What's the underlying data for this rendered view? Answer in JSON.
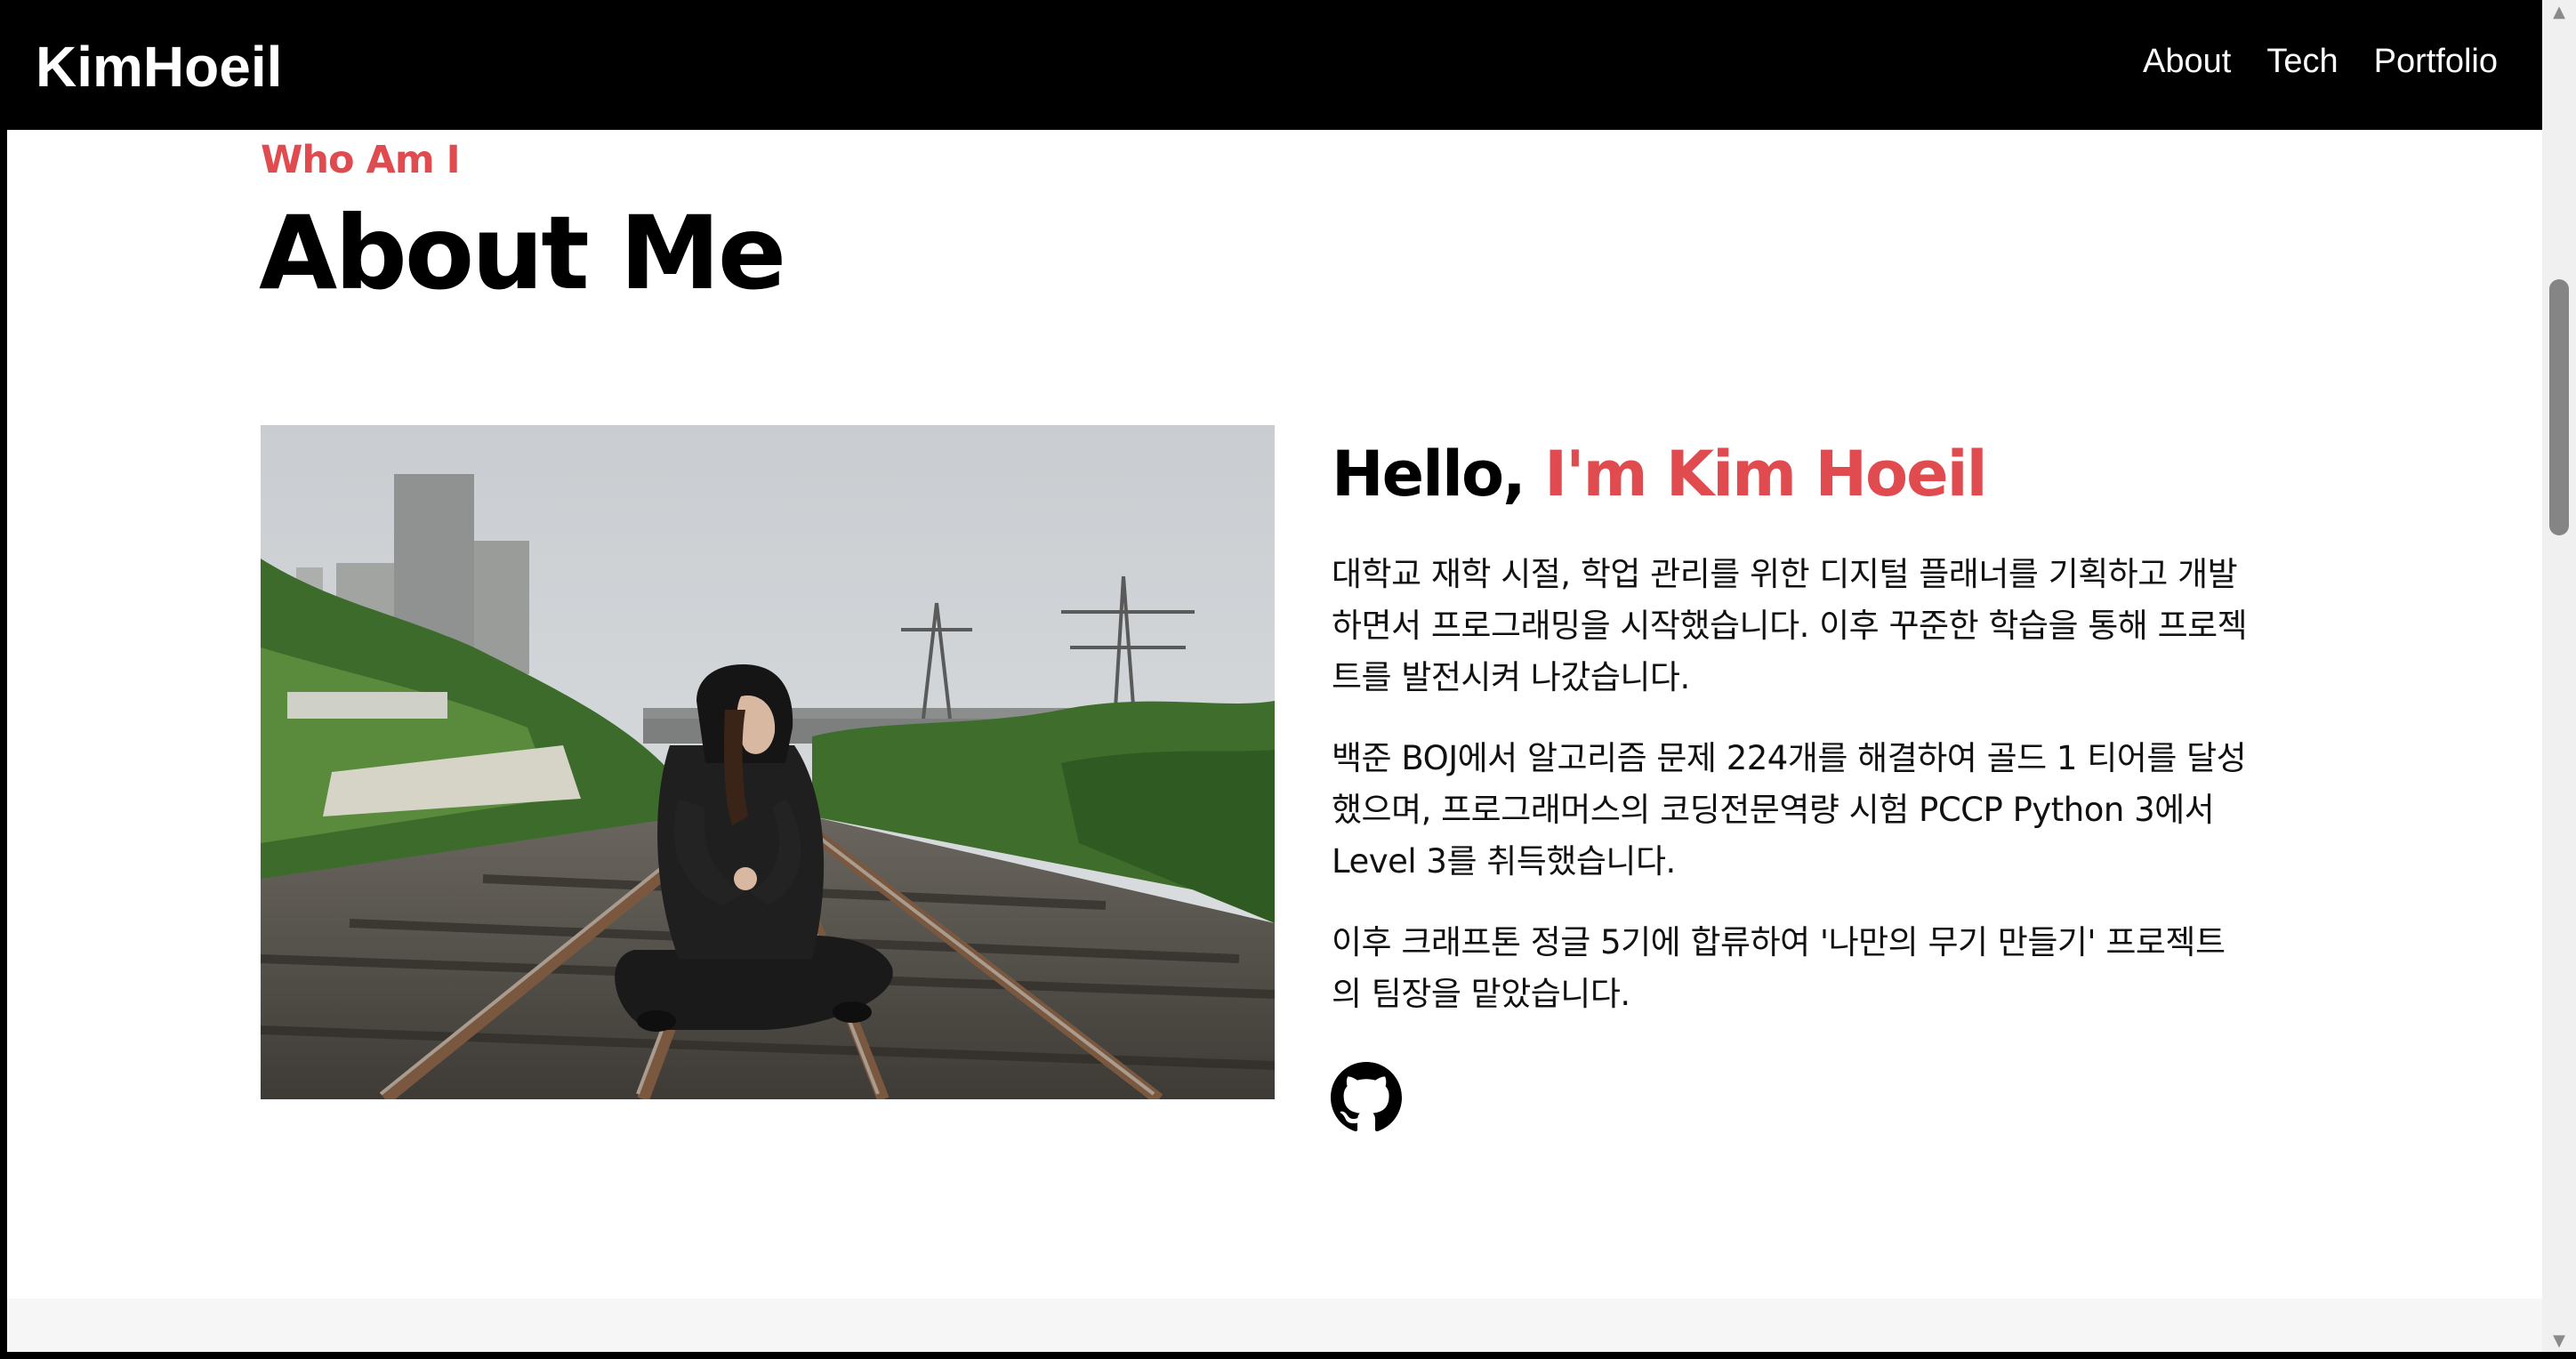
{
  "navbar": {
    "brand": "KimHoeil",
    "links": [
      "About",
      "Tech",
      "Portfolio"
    ]
  },
  "about": {
    "eyebrow": "Who Am I",
    "title": "About Me",
    "hello_prefix": "Hello, ",
    "hello_name": "I'm Kim Hoeil",
    "paragraphs": [
      "대학교 재학 시절, 학업 관리를 위한 디지털 플래너를 기획하고 개발하면서 프로그래밍을 시작했습니다. 이후 꾸준한 학습을 통해 프로젝트를 발전시켜 나갔습니다.",
      "백준 BOJ에서 알고리즘 문제 224개를 해결하여 골드 1 티어를 달성했으며, 프로그래머스의 코딩전문역량 시험 PCCP Python 3에서 Level 3를 취득했습니다.",
      "이후 크래프톤 정글 5기에 합류하여 '나만의 무기 만들기' 프로젝트의 팀장을 맡았습니다."
    ],
    "social_icon": "github-icon"
  },
  "colors": {
    "accent": "#e04b4f",
    "navbar_bg": "#000000"
  }
}
